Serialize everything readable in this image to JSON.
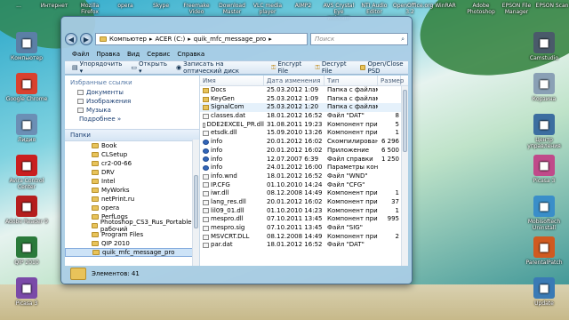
{
  "desktop": {
    "top_labels": [
      "...",
      "Интернет",
      "Mozilla Firefox",
      "opera",
      "Skype",
      "Freemake Video",
      "Download Master",
      "VLC media player",
      "AIMP2",
      "AVS Crystal Eye webcam",
      "NTI Audio Editor",
      "OpenOffice.org 3.2",
      "WinRAR",
      "Adobe Photoshop",
      "EPSON File Manager",
      "EPSON Scan"
    ],
    "left_icons": [
      {
        "label": "Компьютер",
        "icon": "computer-icon",
        "color": "#5b7fa6"
      },
      {
        "label": "Google Chrome",
        "icon": "chrome-icon",
        "color": "#d9412e"
      },
      {
        "label": "Лидия",
        "icon": "user-folder-icon",
        "color": "#6b8fb5"
      },
      {
        "label": "Avira Control Center",
        "icon": "avira-icon",
        "color": "#c91f1f"
      },
      {
        "label": "Adobe Reader 9",
        "icon": "pdf-icon",
        "color": "#b51e1e"
      },
      {
        "label": "QIP 2010",
        "icon": "qip-icon",
        "color": "#2a7a3a"
      },
      {
        "label": "Picasa 3",
        "icon": "picasa-icon",
        "color": "#7a4aa8"
      }
    ],
    "right_icons": [
      {
        "label": "Camstudio",
        "icon": "camera-icon",
        "color": "#4a5a6a"
      },
      {
        "label": "Корзина",
        "icon": "recycle-bin-icon",
        "color": "#8aa0b5"
      },
      {
        "label": "Центр управления",
        "icon": "control-icon",
        "color": "#3c6ea0"
      },
      {
        "label": "Picasa 3",
        "icon": "picasa-icon",
        "color": "#c04a8a"
      },
      {
        "label": "Mobisoftech Uninstall",
        "icon": "uninstall-icon",
        "color": "#3a8ec9"
      },
      {
        "label": "ParentalPatch",
        "icon": "parrot-icon",
        "color": "#d05a20"
      },
      {
        "label": "Update",
        "icon": "update-icon",
        "color": "#3a7ab5"
      }
    ]
  },
  "window": {
    "breadcrumb": [
      "Компьютер",
      "ACER (C:)",
      "quik_mfc_message_pro"
    ],
    "search_placeholder": "Поиск",
    "menu": [
      "Файл",
      "Правка",
      "Вид",
      "Сервис",
      "Справка"
    ],
    "toolbar": {
      "organize": "Упорядочить ▾",
      "open": "Открыть ▾",
      "burn": "Записать на оптический диск",
      "encrypt": "Encrypt File",
      "decrypt": "Decrypt File",
      "openclose": "Open/Close PSD"
    },
    "favorites_header": "Избранные ссылки",
    "favorites": [
      "Документы",
      "Изображения",
      "Музыка",
      "Подробнее »"
    ],
    "folders_header": "Папки",
    "tree": [
      "Book",
      "CLSetup",
      "cr2-00-66",
      "DRV",
      "Intel",
      "MyWorks",
      "netPrint.ru",
      "opera",
      "PerfLogs",
      "Photoshop_CS3_Rus_Portable-рабочий",
      "Program Files",
      "QIP 2010",
      "quik_mfc_message_pro"
    ],
    "tree_selected": 12,
    "columns": [
      "Имя",
      "Дата изменения",
      "Тип",
      "Размер"
    ],
    "files": [
      {
        "name": "Docs",
        "date": "25.03.2012 1:09",
        "type": "Папка с файлами",
        "size": "",
        "icon": "folder"
      },
      {
        "name": "KeyGen",
        "date": "25.03.2012 1:09",
        "type": "Папка с файлами",
        "size": "",
        "icon": "folder"
      },
      {
        "name": "SignalCom",
        "date": "25.03.2012 1:20",
        "type": "Папка с файлами",
        "size": "",
        "icon": "folder"
      },
      {
        "name": "classes.dat",
        "date": "18.01.2012 16:52",
        "type": "Файл \"DAT\"",
        "size": "8",
        "icon": "file"
      },
      {
        "name": "DDE2EXCEL_PR.dll",
        "date": "31.08.2011 19:23",
        "type": "Компонент прил...",
        "size": "5",
        "icon": "file"
      },
      {
        "name": "etsdk.dll",
        "date": "15.09.2010 13:26",
        "type": "Компонент прил...",
        "size": "1",
        "icon": "file"
      },
      {
        "name": "info",
        "date": "20.01.2012 16:02",
        "type": "Скомпилирован...",
        "size": "6 296",
        "icon": "info"
      },
      {
        "name": "info",
        "date": "20.01.2012 16:02",
        "type": "Приложение",
        "size": "6 500",
        "icon": "info"
      },
      {
        "name": "info",
        "date": "12.07.2007 6:39",
        "type": "Файл справки",
        "size": "1 250",
        "icon": "info"
      },
      {
        "name": "info",
        "date": "24.01.2012 16:00",
        "type": "Параметры конф...",
        "size": "",
        "icon": "info"
      },
      {
        "name": "info.wnd",
        "date": "18.01.2012 16:52",
        "type": "Файл \"WND\"",
        "size": "",
        "icon": "file"
      },
      {
        "name": "IP.CFG",
        "date": "01.10.2010 14:24",
        "type": "Файл \"CFG\"",
        "size": "",
        "icon": "file"
      },
      {
        "name": "iwr.dll",
        "date": "08.12.2008 14:49",
        "type": "Компонент прил...",
        "size": "1",
        "icon": "file"
      },
      {
        "name": "lang_res.dll",
        "date": "20.01.2012 16:02",
        "type": "Компонент прил...",
        "size": "37",
        "icon": "file"
      },
      {
        "name": "lil09_01.dll",
        "date": "01.10.2010 14:23",
        "type": "Компонент прил...",
        "size": "1",
        "icon": "file"
      },
      {
        "name": "mespro.dll",
        "date": "07.10.2011 13:45",
        "type": "Компонент прил...",
        "size": "995",
        "icon": "file"
      },
      {
        "name": "mespro.sig",
        "date": "07.10.2011 13:45",
        "type": "Файл \"SIG\"",
        "size": "",
        "icon": "file"
      },
      {
        "name": "MSVCRT.DLL",
        "date": "08.12.2008 14:49",
        "type": "Компонент прил...",
        "size": "2",
        "icon": "file"
      },
      {
        "name": "par.dat",
        "date": "18.01.2012 16:52",
        "type": "Файл \"DAT\"",
        "size": "",
        "icon": "file"
      }
    ],
    "status": "Элементов: 41"
  }
}
